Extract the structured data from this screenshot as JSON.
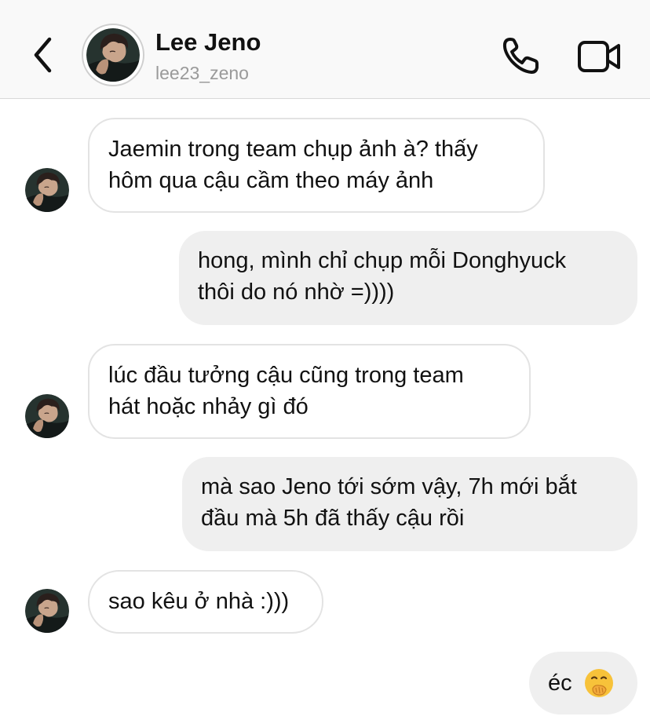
{
  "header": {
    "contact_name": "Lee Jeno",
    "contact_username": "lee23_zeno",
    "icons": {
      "back": "chevron-left-icon",
      "call": "phone-icon",
      "video": "video-camera-icon"
    }
  },
  "messages": [
    {
      "direction": "incoming",
      "text": "Jaemin trong team chụp ảnh à? thấy\nhôm qua cậu cầm theo máy ảnh"
    },
    {
      "direction": "outgoing",
      "text": "hong, mình chỉ chụp mỗi Donghyuck\nthôi do nó nhờ =))))"
    },
    {
      "direction": "incoming",
      "text": "lúc đầu tưởng cậu cũng trong team\nhát hoặc nhảy gì đó"
    },
    {
      "direction": "outgoing",
      "text": "mà sao Jeno tới sớm vậy, 7h mới bắt\nđầu mà 5h đã thấy cậu rồi"
    },
    {
      "direction": "incoming",
      "text": "sao kêu ở nhà :)))"
    },
    {
      "direction": "outgoing",
      "text": "éc",
      "emoji": "face-with-hand-over-mouth-emoji"
    }
  ],
  "colors": {
    "header_bg": "#f9f9f9",
    "incoming_bubble_border": "#e3e3e3",
    "outgoing_bubble_bg": "#efefef",
    "username_gray": "#9a9a9a",
    "emoji_yellow": "#f7c23a"
  }
}
